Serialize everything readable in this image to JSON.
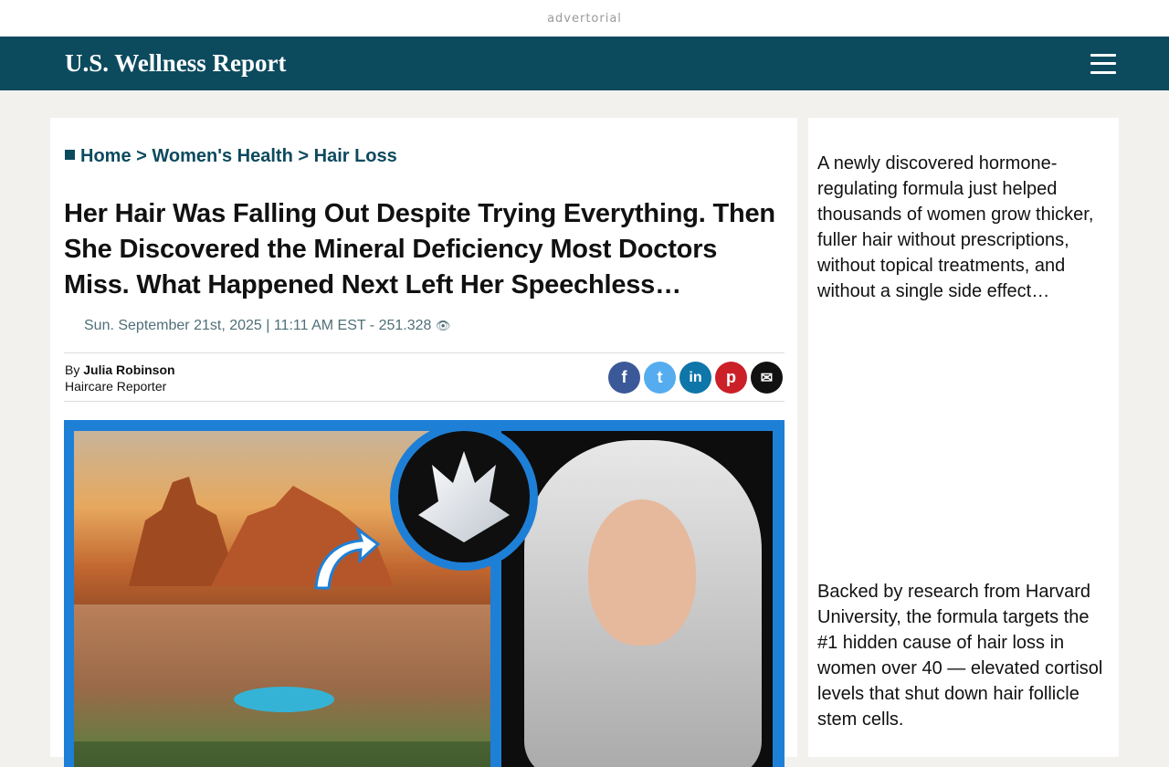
{
  "adbar": {
    "label": "advertorial"
  },
  "header": {
    "brand": "U.S. Wellness Report"
  },
  "breadcrumb": {
    "home": "Home",
    "sep1": ">",
    "cat": "Women's Health",
    "sep2": ">",
    "sub": "Hair Loss"
  },
  "article": {
    "headline": "Her Hair Was Falling Out Despite Trying Everything. Then She Discovered the Mineral Deficiency Most Doctors Miss. What Happened Next Left Her Speechless…",
    "dateline": "Sun. September 21st, 2025 | 11:11 AM EST - 251.328",
    "views_icon": "👁",
    "by_prefix": "By",
    "author_name": "Julia Robinson",
    "author_role": "Haircare Reporter"
  },
  "share": [
    {
      "label": "f",
      "icon": "facebook-icon",
      "color": "#3b5998"
    },
    {
      "label": "t",
      "icon": "twitter-icon",
      "color": "#55acee"
    },
    {
      "label": "in",
      "icon": "linkedin-icon",
      "color": "#0e76a8"
    },
    {
      "label": "p",
      "icon": "pinterest-icon",
      "color": "#cb2027"
    },
    {
      "label": "✉",
      "icon": "email-icon",
      "color": "#111111"
    }
  ],
  "sidebar": {
    "para1": "A newly discovered hormone-regulating formula just helped thousands of women grow thicker, fuller hair without prescriptions, without topical treatments, and without a single side effect…",
    "para2": "Backed by research from Harvard University, the formula targets the #1 hidden cause of hair loss in women over 40 — elevated cortisol levels that shut down hair follicle stem cells."
  }
}
